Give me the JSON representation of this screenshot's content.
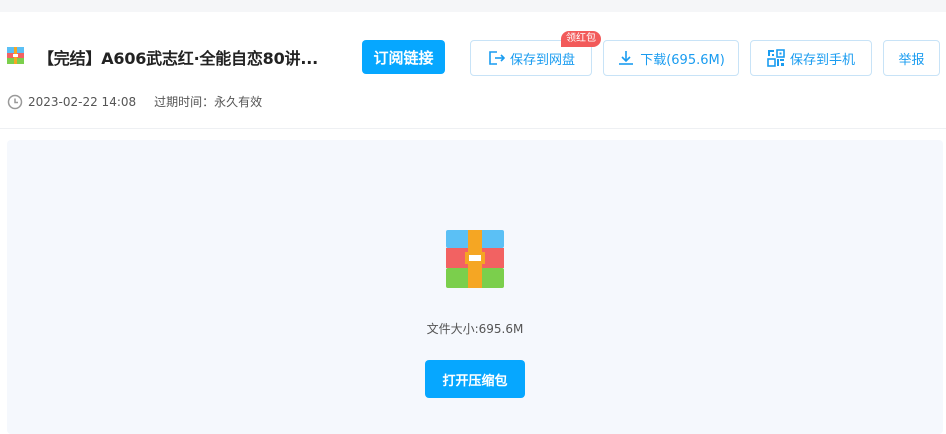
{
  "file": {
    "title": "【完结】A606武志红·全能自恋80讲...",
    "icon": "archive-icon"
  },
  "toolbar": {
    "subscribe_label": "订阅链接",
    "save_cloud_label": "保存到网盘",
    "save_cloud_badge": "领红包",
    "download_label": "下载(695.6M)",
    "save_phone_label": "保存到手机",
    "report_label": "举报"
  },
  "meta": {
    "date": "2023-02-22 14:08",
    "expiry": "过期时间：永久有效"
  },
  "preview": {
    "size_text": "文件大小:695.6M",
    "open_label": "打开压缩包"
  },
  "colors": {
    "primary": "#06a7ff",
    "accent_text": "#1a9cf0",
    "badge": "#f25a5a",
    "preview_bg": "#f5f8fd"
  }
}
